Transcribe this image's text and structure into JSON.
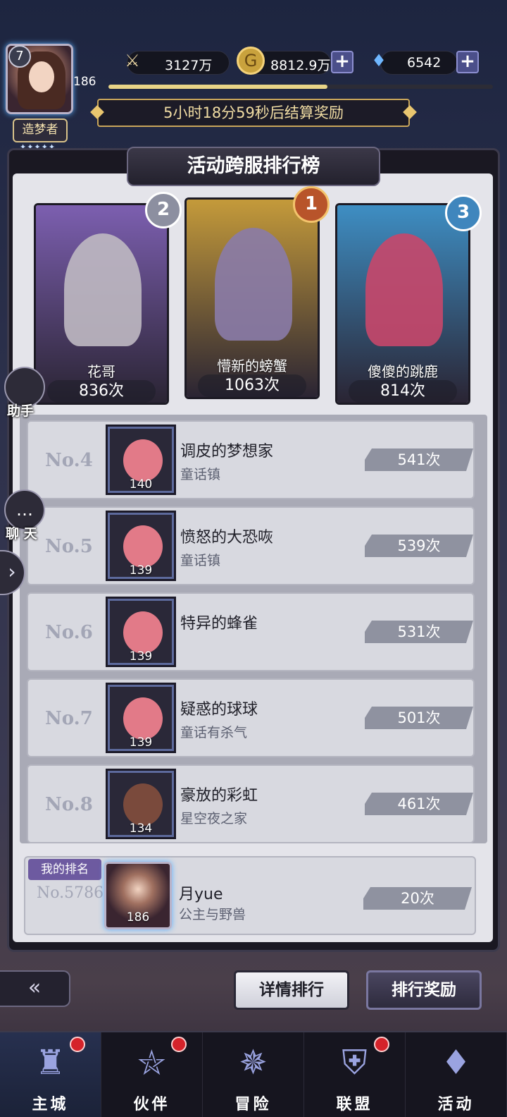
{
  "player": {
    "level": "7",
    "avatar_level": "186",
    "title": "造梦者",
    "title_stars": "✦✦✦✦✦"
  },
  "resources": {
    "power": "3127万",
    "gold": "8812.9万",
    "diamonds": "6542",
    "plus_label": "+",
    "xp_progress": 0.57
  },
  "timer_text": "5小时18分59秒后结算奖励",
  "panel_title": "活动跨服排行榜",
  "top3": [
    {
      "rank": "2",
      "name": "花哥",
      "count": "836次",
      "bg": "#7c5fb0",
      "char": "#bfb9c2"
    },
    {
      "rank": "1",
      "name": "懵新的螃蟹",
      "count": "1063次",
      "bg": "#c49a3a",
      "char": "#8a7ba8"
    },
    {
      "rank": "3",
      "name": "傻傻的跳鹿",
      "count": "814次",
      "bg": "#3e8ec3",
      "char": "#c8476a"
    }
  ],
  "ranks": [
    {
      "no": "No.4",
      "name": "调皮的梦想家",
      "guild": "童话镇",
      "level": "140",
      "score": "541次",
      "face": "#e27a88"
    },
    {
      "no": "No.5",
      "name": "愤怒的大恐咴",
      "guild": "童话镇",
      "level": "139",
      "score": "539次",
      "face": "#e27a88"
    },
    {
      "no": "No.6",
      "name": "特异的蜂雀",
      "guild": "",
      "level": "139",
      "score": "531次",
      "face": "#e27a88"
    },
    {
      "no": "No.7",
      "name": "疑惑的球球",
      "guild": "童话有杀气",
      "level": "139",
      "score": "501次",
      "face": "#e27a88"
    },
    {
      "no": "No.8",
      "name": "豪放的彩虹",
      "guild": "星空夜之家",
      "level": "134",
      "score": "461次",
      "face": "#7a4a3c"
    }
  ],
  "my_rank": {
    "tag": "我的排名",
    "no": "No.5786",
    "name": "月yue",
    "guild": "公主与野兽",
    "level": "186",
    "score": "20次"
  },
  "side": {
    "assistant": "助手",
    "chat": "聊 天",
    "arrow": "›"
  },
  "actions": {
    "back": "«",
    "detail": "详情排行",
    "reward": "排行奖励"
  },
  "nav": [
    {
      "label": "主城",
      "icon": "castle-icon",
      "glyph": "♜",
      "active": true,
      "dot": true
    },
    {
      "label": "伙伴",
      "icon": "witch-hat-icon",
      "glyph": "⛥",
      "active": false,
      "dot": true
    },
    {
      "label": "冒险",
      "icon": "compass-icon",
      "glyph": "✵",
      "active": false,
      "dot": false
    },
    {
      "label": "联盟",
      "icon": "shield-icon",
      "glyph": "⛨",
      "active": false,
      "dot": true
    },
    {
      "label": "活动",
      "icon": "cards-icon",
      "glyph": "♦",
      "active": false,
      "dot": false
    }
  ],
  "colors": {
    "accent_gold": "#c9a65a",
    "panel_bg": "#e4e4ea",
    "score_pill": "#8f92a0",
    "notify_red": "#d5232a"
  }
}
